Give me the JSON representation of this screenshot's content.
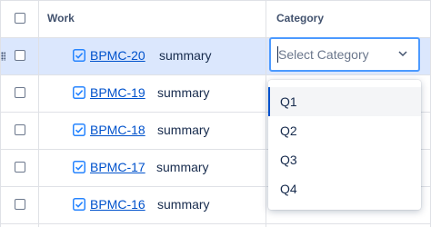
{
  "table": {
    "columns": [
      "Work",
      "Category"
    ],
    "rows": [
      {
        "key": "BPMC-20",
        "summary": "summary"
      },
      {
        "key": "BPMC-19",
        "summary": "summary"
      },
      {
        "key": "BPMC-18",
        "summary": "summary"
      },
      {
        "key": "BPMC-17",
        "summary": "summary"
      },
      {
        "key": "BPMC-16",
        "summary": "summary"
      }
    ]
  },
  "category_select": {
    "placeholder": "Select Category",
    "options": [
      "Q1",
      "Q2",
      "Q3",
      "Q4"
    ]
  },
  "colors": {
    "link": "#0052cc",
    "selected_row": "#dbe7fd",
    "focus_border": "#4c9aff",
    "task_icon": "#2684ff"
  },
  "icons": {
    "task": "task-checkbox-icon",
    "chevron": "chevron-down-icon",
    "drag": "drag-handle-icon"
  }
}
